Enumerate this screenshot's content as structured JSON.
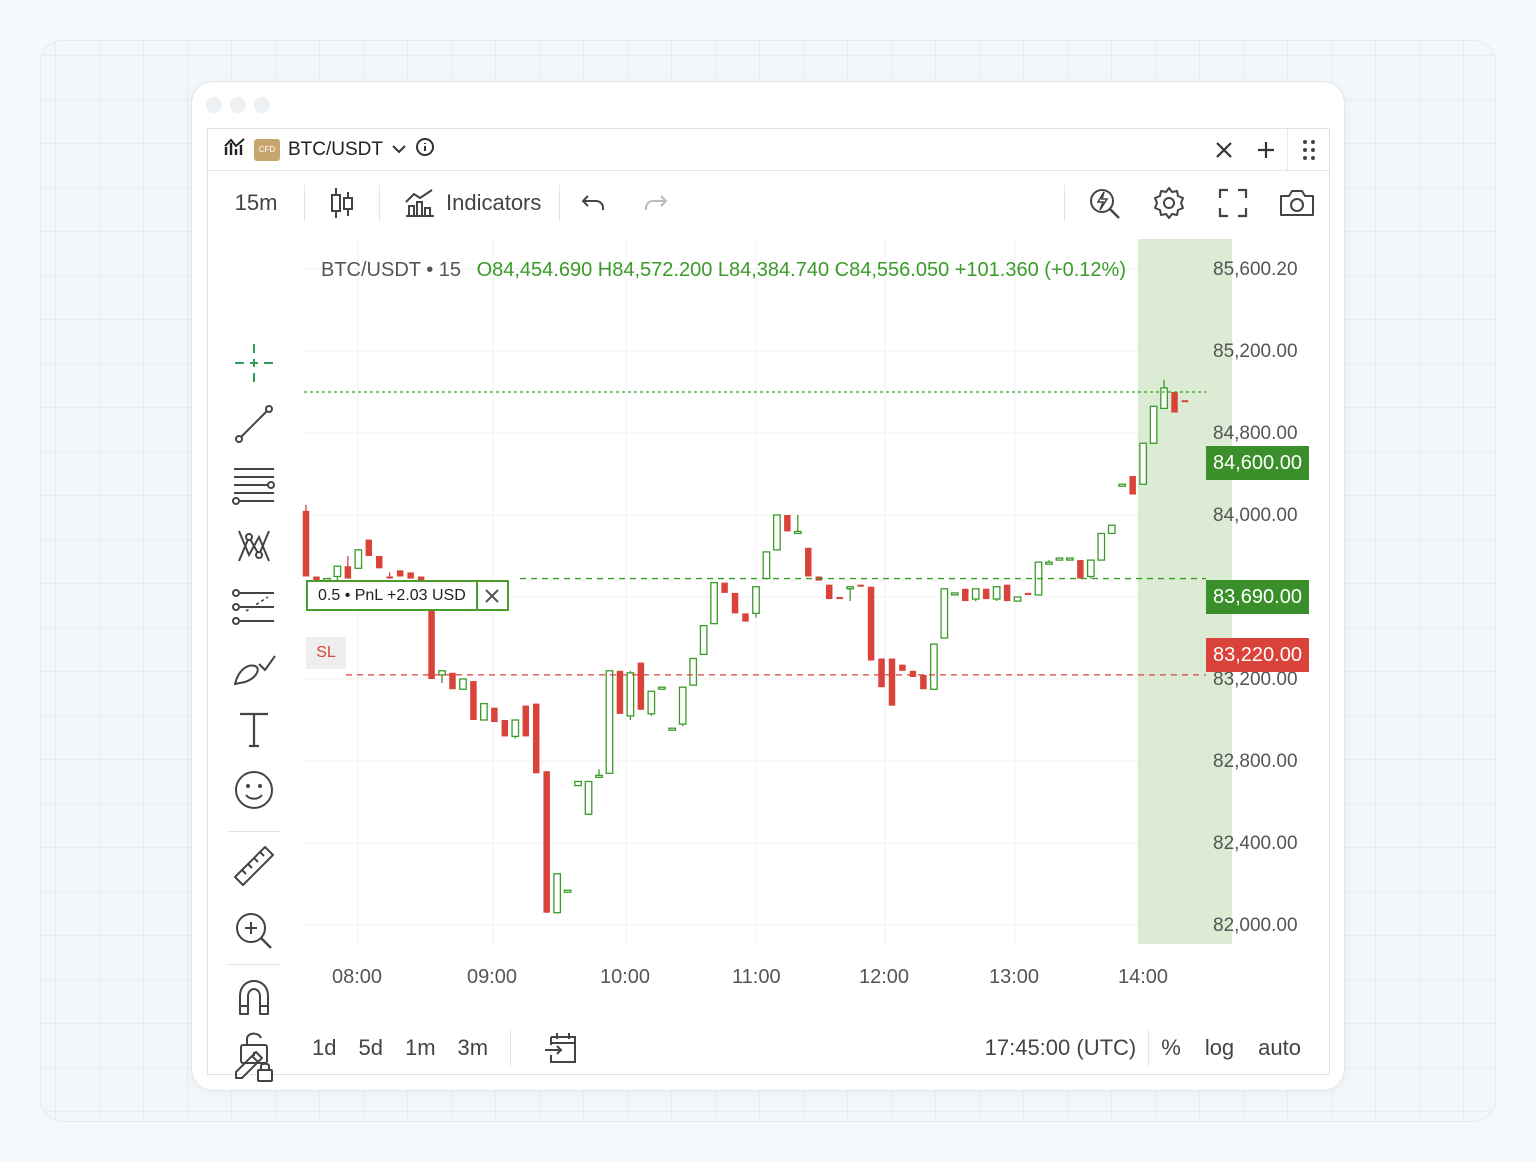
{
  "header": {
    "cfd_badge": "CFD",
    "symbol": "BTC/USDT"
  },
  "toolbar": {
    "timeframe": "15m",
    "indicators_label": "Indicators"
  },
  "legend": {
    "symbol": "BTC/USDT • 15",
    "ohlc": "O84,454.690 H84,572.200 L84,384.740 C84,556.050 +101.360 (+0.12%)"
  },
  "price_axis": [
    "85,600.20",
    "85,200.00",
    "84,800.00",
    "84,000.00",
    "83,200.00",
    "82,800.00",
    "82,400.00",
    "82,000.00"
  ],
  "time_axis": [
    "08:00",
    "09:00",
    "10:00",
    "11:00",
    "12:00",
    "13:00",
    "14:00"
  ],
  "tags": {
    "last_price": "84,600.00",
    "entry_price": "83,690.00",
    "stop_loss_price": "83,220.00"
  },
  "order": {
    "text": "0.5  •  PnL +2.03 USD",
    "sl_label": "SL"
  },
  "bottom": {
    "ranges": [
      "1d",
      "5d",
      "1m",
      "3m"
    ],
    "time": "17:45:00 (UTC)",
    "percent": "%",
    "log": "log",
    "auto": "auto"
  },
  "colors": {
    "up": "#3a9b28",
    "down": "#d9433a",
    "highlight": "#dcebd3"
  },
  "chart_data": {
    "type": "candlestick",
    "x_labels": [
      "08:00",
      "09:00",
      "10:00",
      "11:00",
      "12:00",
      "13:00",
      "14:00"
    ],
    "ylim": [
      81850,
      85650
    ],
    "horizontal_lines": [
      84600,
      83690,
      83220
    ],
    "candles": [
      [
        84020,
        84050,
        83700,
        83700
      ],
      [
        83700,
        83700,
        83680,
        83650
      ],
      [
        83690,
        83740,
        83740,
        83690
      ],
      [
        83700,
        83750,
        83680,
        83750
      ],
      [
        83750,
        83800,
        83690,
        83690
      ],
      [
        83740,
        83830,
        83740,
        83830
      ],
      [
        83880,
        83880,
        83800,
        83800
      ],
      [
        83800,
        83800,
        83740,
        83740
      ],
      [
        83700,
        83720,
        83690,
        83690
      ],
      [
        83730,
        83730,
        83700,
        83700
      ],
      [
        83720,
        83720,
        83690,
        83690
      ],
      [
        83700,
        83700,
        83580,
        83580
      ],
      [
        83630,
        83630,
        83200,
        83200
      ],
      [
        83220,
        83240,
        83180,
        83240
      ],
      [
        83230,
        83230,
        83150,
        83150
      ],
      [
        83150,
        83200,
        83150,
        83200
      ],
      [
        83190,
        83190,
        83000,
        83000
      ],
      [
        83000,
        83080,
        83000,
        83080
      ],
      [
        83060,
        83060,
        82990,
        82990
      ],
      [
        83000,
        83000,
        82920,
        82920
      ],
      [
        82920,
        83000,
        82910,
        83000
      ],
      [
        83070,
        83070,
        82920,
        82920
      ],
      [
        83080,
        83080,
        82740,
        82740
      ],
      [
        82750,
        82750,
        82060,
        82060
      ],
      [
        82060,
        82250,
        82060,
        82250
      ],
      [
        82170,
        82170,
        82170,
        82170
      ],
      [
        82680,
        82700,
        82680,
        82700
      ],
      [
        82540,
        82700,
        82540,
        82700
      ],
      [
        82730,
        82760,
        82730,
        82730
      ],
      [
        82740,
        83240,
        82740,
        83240
      ],
      [
        83240,
        83240,
        83030,
        83030
      ],
      [
        83020,
        83240,
        83000,
        83230
      ],
      [
        83280,
        83280,
        83050,
        83050
      ],
      [
        83030,
        83140,
        83020,
        83140
      ],
      [
        83160,
        83160,
        83160,
        83160
      ],
      [
        82960,
        82960,
        82950,
        82960
      ],
      [
        82980,
        83160,
        82970,
        83160
      ],
      [
        83170,
        83300,
        83170,
        83300
      ],
      [
        83320,
        83460,
        83320,
        83460
      ],
      [
        83470,
        83670,
        83470,
        83670
      ],
      [
        83670,
        83670,
        83620,
        83620
      ],
      [
        83620,
        83620,
        83520,
        83520
      ],
      [
        83520,
        83520,
        83480,
        83480
      ],
      [
        83520,
        83650,
        83500,
        83650
      ],
      [
        83690,
        83820,
        83690,
        83820
      ],
      [
        83830,
        84000,
        83830,
        84000
      ],
      [
        84000,
        84000,
        83920,
        83920
      ],
      [
        83920,
        84000,
        83920,
        83920
      ],
      [
        83840,
        83840,
        83700,
        83700
      ],
      [
        83700,
        83700,
        83680,
        83680
      ],
      [
        83660,
        83660,
        83590,
        83590
      ],
      [
        83600,
        83600,
        83590,
        83590
      ],
      [
        83650,
        83650,
        83580,
        83650
      ],
      [
        83660,
        83660,
        83650,
        83650
      ],
      [
        83650,
        83650,
        83290,
        83290
      ],
      [
        83300,
        83300,
        83160,
        83160
      ],
      [
        83300,
        83300,
        83070,
        83070
      ],
      [
        83270,
        83270,
        83240,
        83240
      ],
      [
        83240,
        83240,
        83210,
        83210
      ],
      [
        83220,
        83220,
        83150,
        83150
      ],
      [
        83150,
        83370,
        83150,
        83370
      ],
      [
        83400,
        83640,
        83400,
        83640
      ],
      [
        83620,
        83620,
        83620,
        83620
      ],
      [
        83640,
        83640,
        83580,
        83580
      ],
      [
        83590,
        83640,
        83580,
        83640
      ],
      [
        83640,
        83640,
        83590,
        83590
      ],
      [
        83590,
        83650,
        83580,
        83650
      ],
      [
        83660,
        83660,
        83580,
        83580
      ],
      [
        83580,
        83600,
        83580,
        83600
      ],
      [
        83620,
        83620,
        83610,
        83610
      ],
      [
        83610,
        83770,
        83610,
        83770
      ],
      [
        83770,
        83780,
        83770,
        83770
      ],
      [
        83780,
        83790,
        83780,
        83790
      ],
      [
        83790,
        83790,
        83790,
        83790
      ],
      [
        83780,
        83780,
        83690,
        83690
      ],
      [
        83700,
        83780,
        83690,
        83780
      ],
      [
        83780,
        83910,
        83780,
        83910
      ],
      [
        83910,
        83950,
        83910,
        83950
      ],
      [
        84150,
        84150,
        84150,
        84150
      ],
      [
        84190,
        84190,
        84100,
        84100
      ],
      [
        84150,
        84350,
        84150,
        84350
      ],
      [
        84350,
        84530,
        84350,
        84530
      ],
      [
        84520,
        84660,
        84520,
        84620
      ],
      [
        84600,
        84600,
        84500,
        84500
      ],
      [
        84560,
        84560,
        84560,
        84556
      ]
    ],
    "highlight_range_candles": [
      80,
      88
    ]
  }
}
